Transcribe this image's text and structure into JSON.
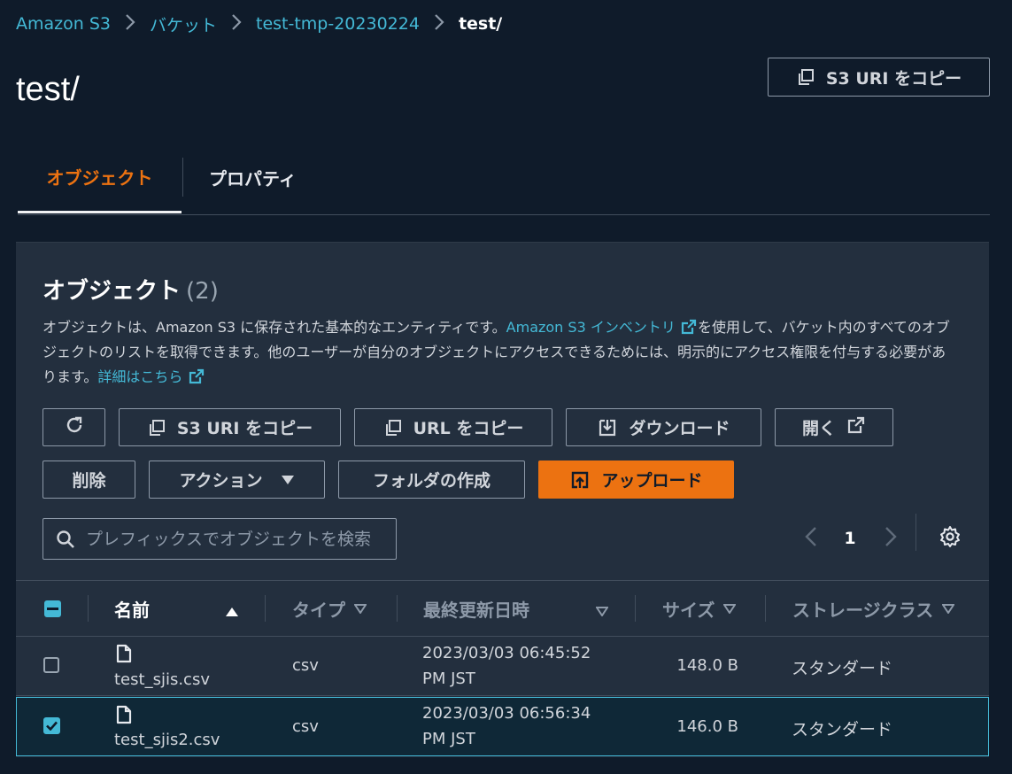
{
  "breadcrumb": {
    "items": [
      "Amazon S3",
      "バケット",
      "test-tmp-20230224"
    ],
    "current": "test/"
  },
  "page": {
    "title": "test/",
    "copy_uri_button": "S3 URI をコピー"
  },
  "tabs": [
    {
      "label": "オブジェクト",
      "active": true
    },
    {
      "label": "プロパティ",
      "active": false
    }
  ],
  "objects_panel": {
    "title": "オブジェクト",
    "count": "(2)",
    "description": {
      "part1": "オブジェクトは、Amazon S3 に保存された基本的なエンティティです。",
      "inventory_link": "Amazon S3 インベントリ",
      "part2": "を使用して、バケット内のすべてのオブジェクトのリストを取得できます。他のユーザーが自分のオブジェクトにアクセスできるためには、明示的にアクセス権限を付与する必要があります。",
      "details_link": "詳細はこちら"
    },
    "toolbar": {
      "copy_s3_uri": "S3 URI をコピー",
      "copy_url": "URL をコピー",
      "download": "ダウンロード",
      "open": "開く",
      "delete": "削除",
      "actions": "アクション",
      "create_folder": "フォルダの作成",
      "upload": "アップロード"
    },
    "search": {
      "placeholder": "プレフィックスでオブジェクトを検索"
    },
    "pagination": {
      "current_page": "1"
    },
    "table": {
      "columns": {
        "name": "名前",
        "type": "タイプ",
        "last_modified": "最終更新日時",
        "size": "サイズ",
        "storage_class": "ストレージクラス"
      },
      "rows": [
        {
          "name": "test_sjis.csv",
          "type": "csv",
          "modified_line1": "2023/03/03 06:45:52",
          "modified_line2": "PM JST",
          "size": "148.0 B",
          "storage_class": "スタンダード",
          "selected": false
        },
        {
          "name": "test_sjis2.csv",
          "type": "csv",
          "modified_line1": "2023/03/03 06:56:34",
          "modified_line2": "PM JST",
          "size": "146.0 B",
          "storage_class": "スタンダード",
          "selected": true
        }
      ]
    }
  },
  "colors": {
    "background": "#0f1b2a",
    "panel": "#232f3e",
    "accent": "#ec7211",
    "link": "#44b9d6",
    "border": "#8d99a8"
  }
}
